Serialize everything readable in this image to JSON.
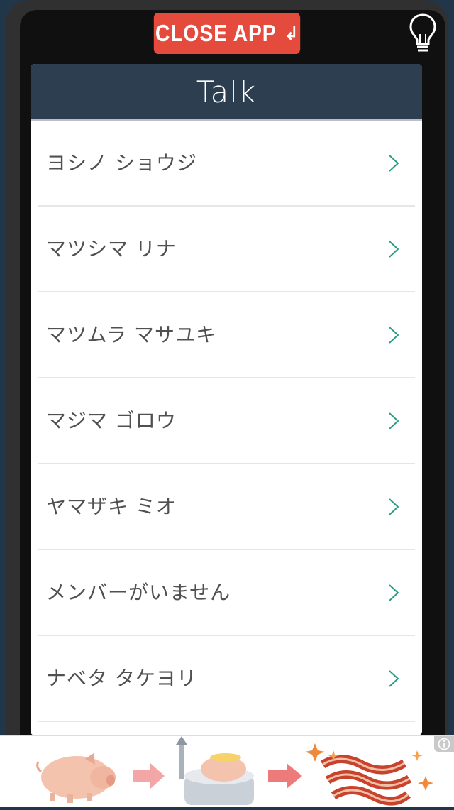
{
  "header": {
    "close_label": "CLOSE APP",
    "close_icon": "return-arrow-icon",
    "hint_icon": "lightbulb-icon"
  },
  "card": {
    "title": "Talk"
  },
  "talk_list": [
    {
      "name": "ヨシノ ショウジ"
    },
    {
      "name": "マツシマ リナ"
    },
    {
      "name": "マツムラ マサユキ"
    },
    {
      "name": "マジマ ゴロウ"
    },
    {
      "name": "ヤマザキ ミオ"
    },
    {
      "name": "メンバーがいません"
    },
    {
      "name": "ナベタ タケヨリ"
    }
  ],
  "colors": {
    "accent": "#e54b3d",
    "header_bg": "#2d3e50",
    "chevron": "#2a9d84",
    "background": "#22364a"
  },
  "ad": {
    "info_icon": "info-icon"
  }
}
